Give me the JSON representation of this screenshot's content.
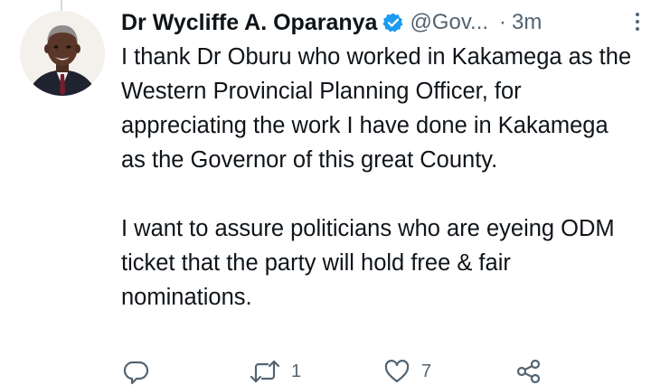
{
  "tweet": {
    "author_name": "Dr Wycliffe A. Oparanya",
    "handle": "@Gov...",
    "separator": "·",
    "time": "3m",
    "paragraphs": [
      "I thank Dr Oburu who worked in Kakamega as the Western Provincial Planning Officer, for appreciating the work I have done in Kakamega as the Governor of this great County.",
      "I want to assure politicians who are eyeing ODM ticket that the party will hold free & fair nominations."
    ],
    "stats": {
      "retweets": "1",
      "likes": "7"
    }
  },
  "icons": {
    "verified": "verified-badge-icon",
    "more": "more-options-icon",
    "reply": "reply-icon",
    "retweet": "retweet-icon",
    "like": "like-icon",
    "share": "share-icon"
  },
  "colors": {
    "text": "#0f1419",
    "secondary": "#536471",
    "verified_blue": "#1d9bf0",
    "thread_line": "#cfd9de"
  }
}
